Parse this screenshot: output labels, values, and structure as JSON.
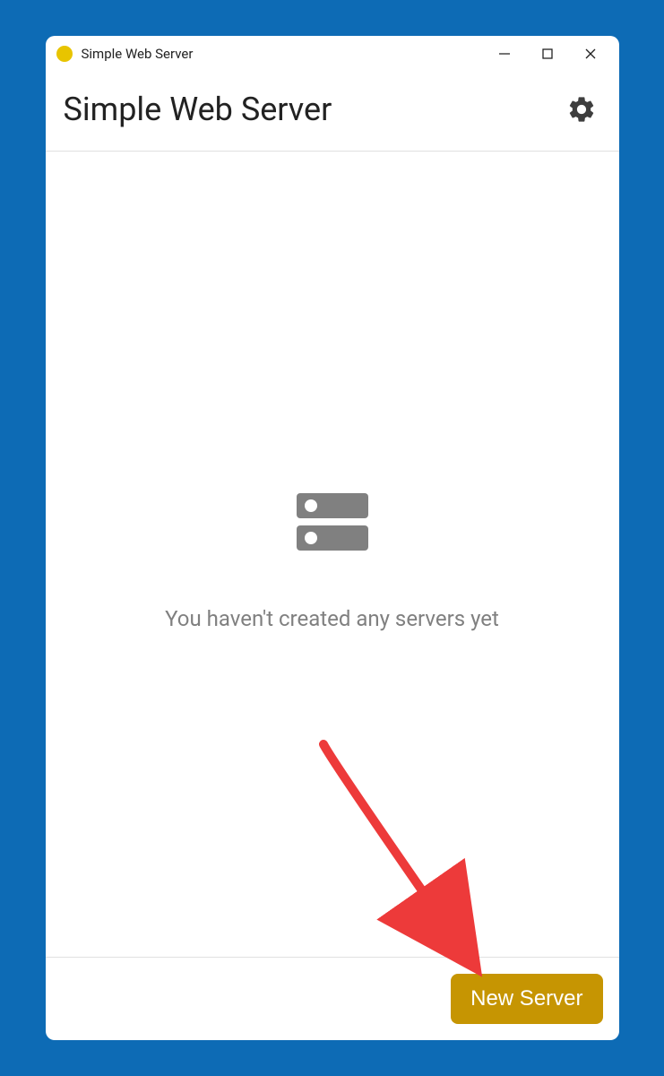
{
  "titlebar": {
    "title": "Simple Web Server"
  },
  "header": {
    "title": "Simple Web Server"
  },
  "content": {
    "empty_message": "You haven't created any servers yet"
  },
  "footer": {
    "new_server_label": "New Server"
  }
}
